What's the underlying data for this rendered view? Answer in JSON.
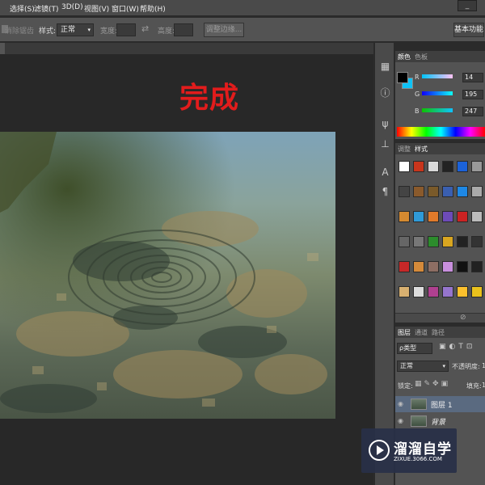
{
  "menubar": {
    "items": [
      "选择(S)",
      "滤镜(T)",
      "3D(D)",
      "视图(V)",
      "窗口(W)",
      "帮助(H)"
    ],
    "min_icon": "minimize-icon"
  },
  "options_bar": {
    "feather_label": "消除锯齿",
    "style_label": "样式:",
    "style_value": "正常",
    "width_label": "宽度:",
    "height_label": "高度:",
    "refine_button": "调整边缘...",
    "workspace_button": "基本功能"
  },
  "canvas": {
    "title": "完成",
    "title_color": "#e21c1c"
  },
  "color_panel": {
    "tabs": [
      "颜色",
      "色板"
    ],
    "r_label": "R",
    "r_value": "14",
    "g_label": "G",
    "g_value": "195",
    "b_label": "B",
    "b_value": "247",
    "foreground": "#0ec3f7"
  },
  "styles_panel": {
    "tabs": [
      "调整",
      "样式"
    ]
  },
  "layers_panel": {
    "tabs": [
      "图层",
      "通道",
      "路径"
    ],
    "kind_label": "ρ类型",
    "blend_mode": "正常",
    "opacity_label": "不透明度:",
    "opacity_value": "1",
    "lock_label": "锁定:",
    "fill_label": "填充:",
    "fill_value": "1",
    "layers": [
      {
        "name": "图层 1"
      },
      {
        "name": "背景"
      }
    ]
  },
  "watermark": {
    "name": "溜溜自学",
    "url": "ZIXUE.3066.COM"
  }
}
